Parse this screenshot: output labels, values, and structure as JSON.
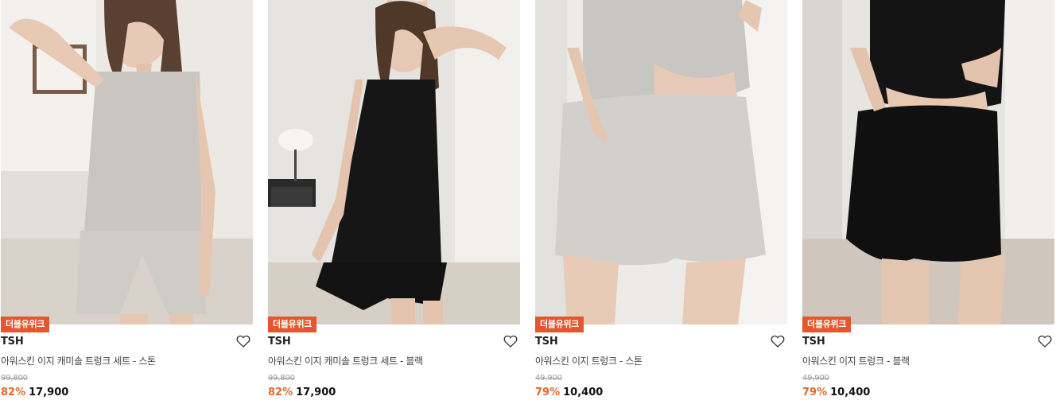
{
  "products": [
    {
      "badge": "더블유위크",
      "brand": "TSH",
      "name": "아워스킨 이지 캐미솔 트렁크 세트 - 스톤",
      "original_price": "99,800",
      "discount": "82%",
      "price": "17,900",
      "colors": {
        "top": "#c9c6c1",
        "bottom": "#cfccc7",
        "bg": "#ece9e5"
      }
    },
    {
      "badge": "더블유위크",
      "brand": "TSH",
      "name": "아워스킨 이지 캐미솔 트렁크 세트 - 블랙",
      "original_price": "99,800",
      "discount": "82%",
      "price": "17,900",
      "colors": {
        "top": "#161616",
        "bottom": "#121212",
        "bg": "#e6e4e0"
      }
    },
    {
      "badge": "더블유위크",
      "brand": "TSH",
      "name": "아워스킨 이지 트렁크 - 스톤",
      "original_price": "49,900",
      "discount": "79%",
      "price": "10,400",
      "colors": {
        "top": "#c8c6c2",
        "bottom": "#d2d0cc",
        "bg": "#ecebe8"
      }
    },
    {
      "badge": "더블유위크",
      "brand": "TSH",
      "name": "아워스킨 이지 트렁크 - 블랙",
      "original_price": "49,900",
      "discount": "79%",
      "price": "10,400",
      "colors": {
        "top": "#141414",
        "bottom": "#101010",
        "bg": "#e7e5e1"
      }
    }
  ],
  "icons": {
    "wishlist": "heart-outline-icon"
  },
  "theme": {
    "badge_color": "#e4572e",
    "discount_color": "#e4672a"
  }
}
